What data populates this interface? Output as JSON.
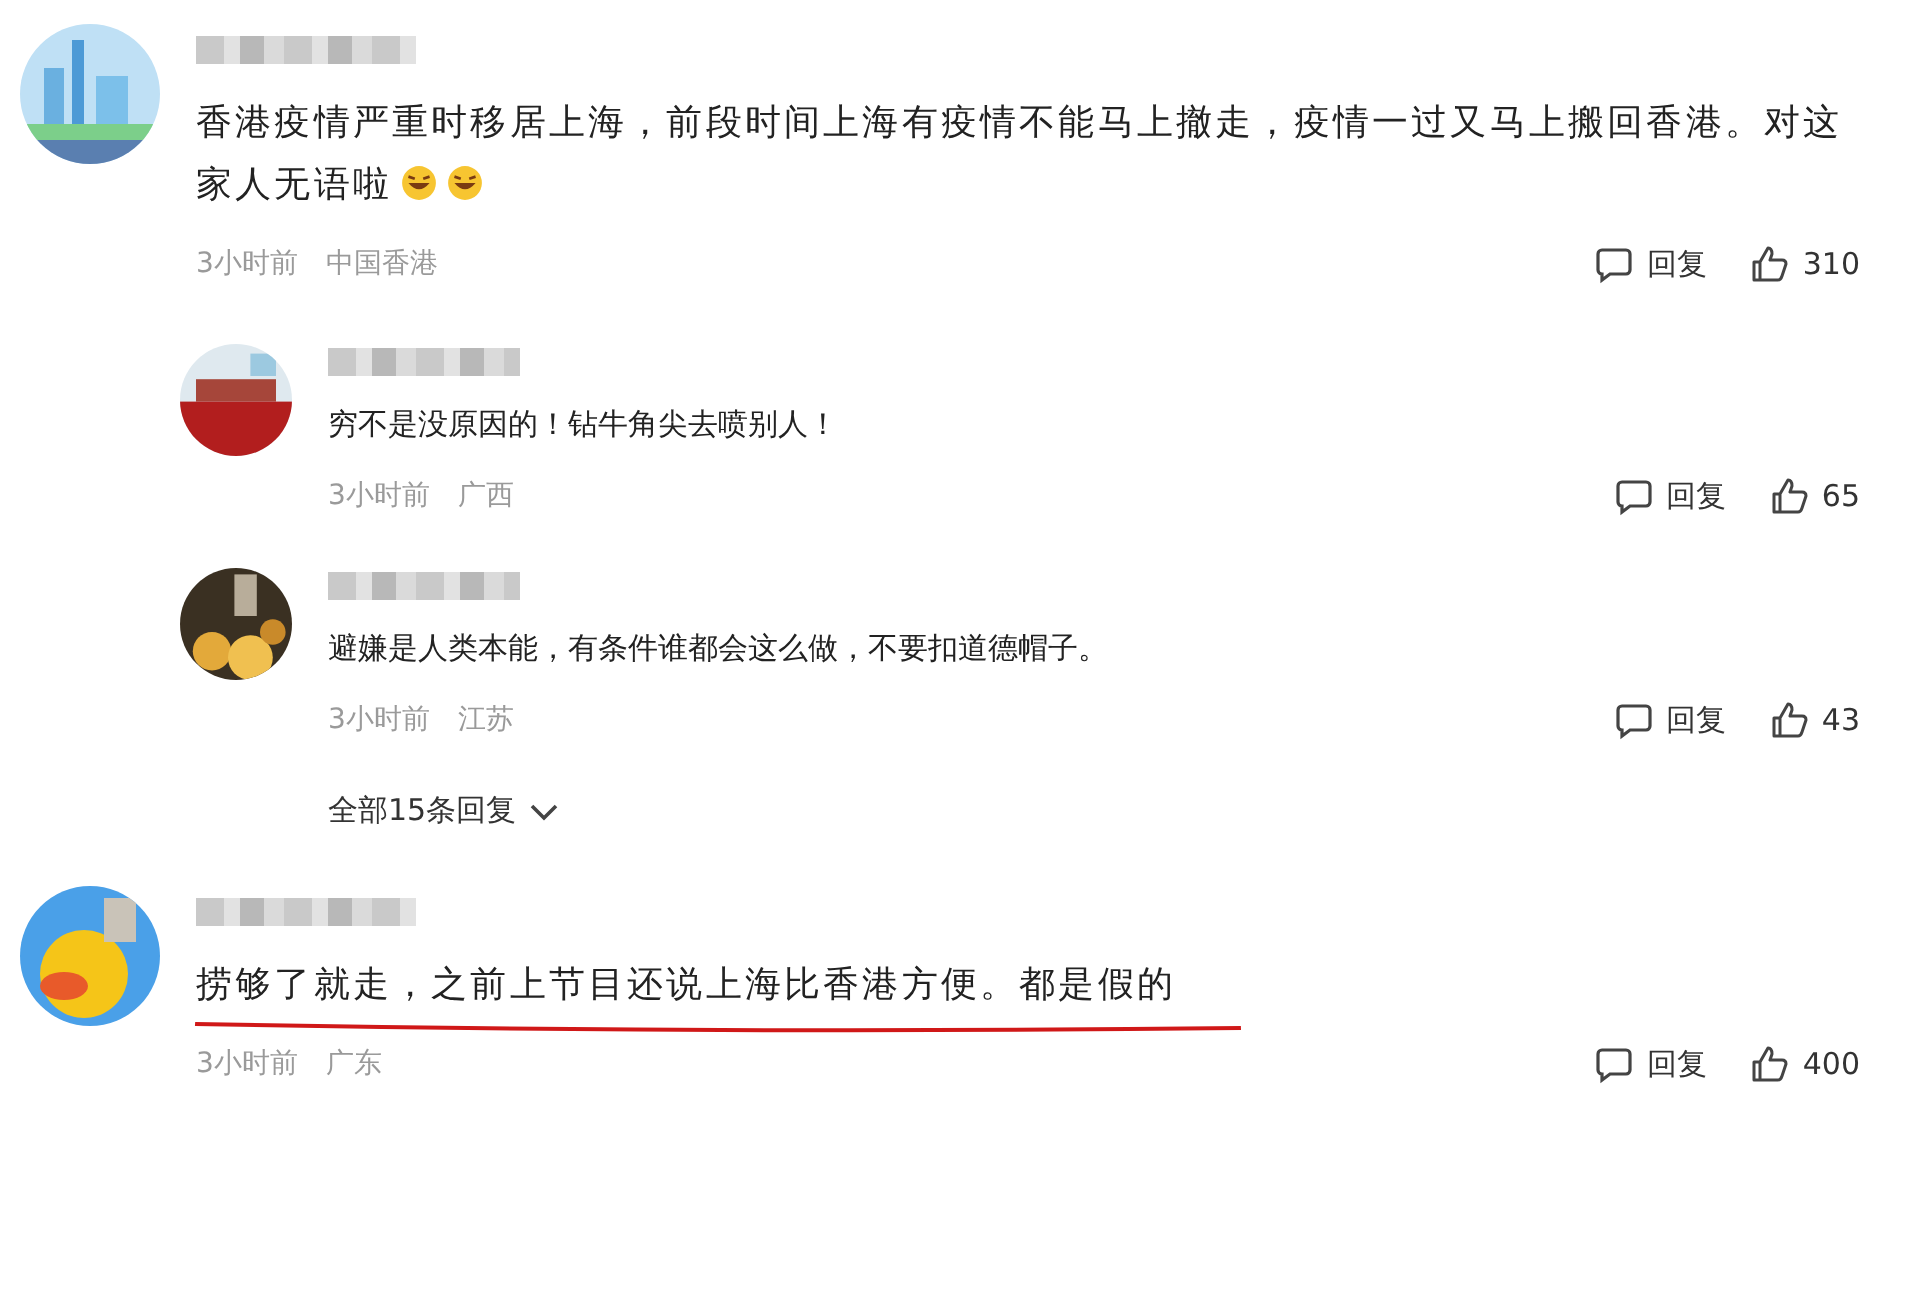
{
  "comments": [
    {
      "text": "香港疫情严重时移居上海，前段时间上海有疫情不能马上撤走，疫情一过又马上搬回香港。对这家人无语啦",
      "trailing_emojis": true,
      "time": "3小时前",
      "location": "中国香港",
      "reply_label": "回复",
      "likes": "310",
      "underlined": false,
      "replies": [
        {
          "text": "穷不是没原因的！钻牛角尖去喷别人！",
          "time": "3小时前",
          "location": "广西",
          "reply_label": "回复",
          "likes": "65"
        },
        {
          "text": "避嫌是人类本能，有条件谁都会这么做，不要扣道德帽子。",
          "time": "3小时前",
          "location": "江苏",
          "reply_label": "回复",
          "likes": "43"
        }
      ],
      "more_replies": "全部15条回复"
    },
    {
      "text": "捞够了就走，之前上节目还说上海比香港方便。都是假的",
      "time": "3小时前",
      "location": "广东",
      "reply_label": "回复",
      "likes": "400",
      "underlined": true
    }
  ]
}
